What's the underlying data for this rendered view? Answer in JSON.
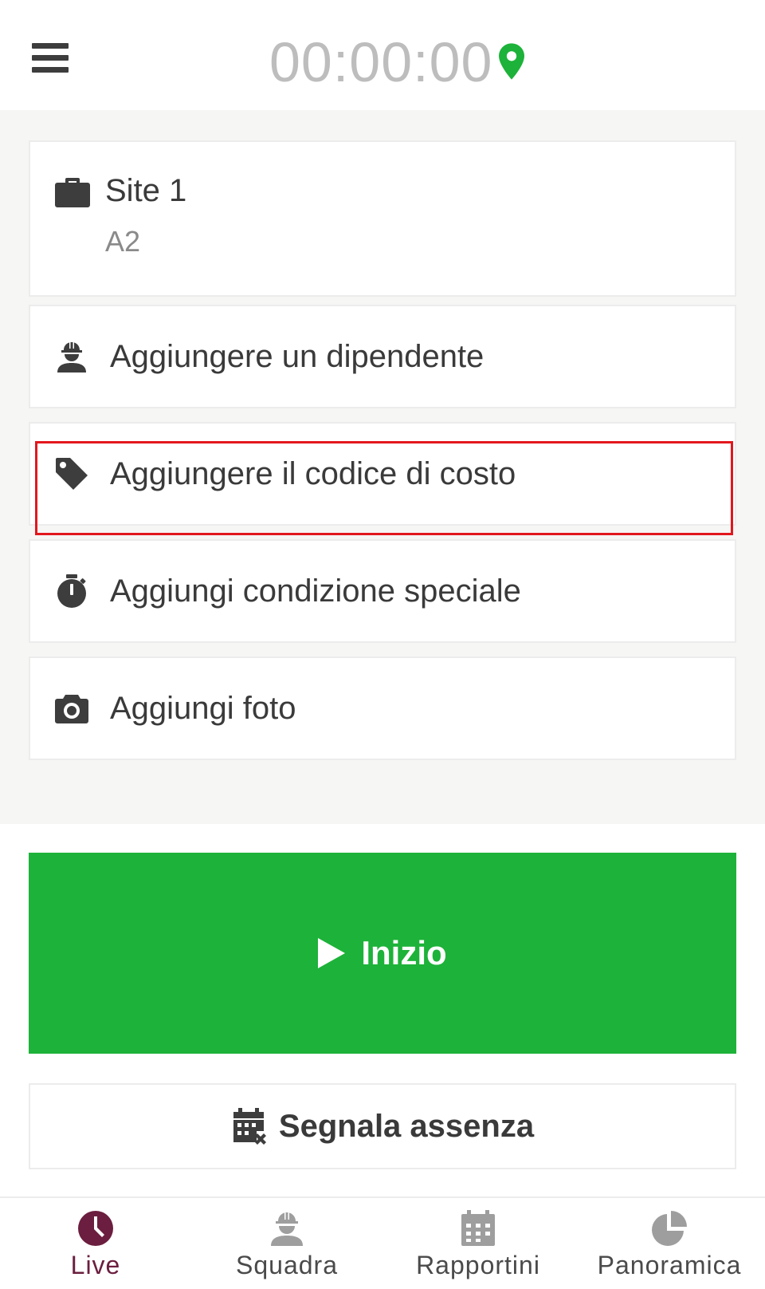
{
  "header": {
    "timer": "00:00:00",
    "menu_icon": "hamburger-menu-icon",
    "location_icon": "location-pin-icon",
    "location_color": "#1db239"
  },
  "site": {
    "name": "Site 1",
    "subtitle": "A2",
    "icon": "briefcase-icon"
  },
  "actions": [
    {
      "label": "Aggiungere un dipendente",
      "icon": "worker-icon"
    },
    {
      "label": "Aggiungere il codice di costo",
      "icon": "tag-icon",
      "highlighted": true
    },
    {
      "label": "Aggiungi condizione speciale",
      "icon": "stopwatch-icon"
    },
    {
      "label": "Aggiungi foto",
      "icon": "camera-icon"
    }
  ],
  "start_button": {
    "label": "Inizio",
    "icon": "play-icon",
    "color": "#1db239"
  },
  "absence_button": {
    "label": "Segnala assenza",
    "icon": "calendar-x-icon"
  },
  "bottom_nav": [
    {
      "label": "Live",
      "icon": "clock-icon",
      "active": true
    },
    {
      "label": "Squadra",
      "icon": "worker-icon",
      "active": false
    },
    {
      "label": "Rapportini",
      "icon": "calendar-icon",
      "active": false
    },
    {
      "label": "Panoramica",
      "icon": "pie-chart-icon",
      "active": false
    }
  ],
  "colors": {
    "accent": "#6b1e3f",
    "highlight": "#e2171d",
    "primary_green": "#1db239"
  }
}
